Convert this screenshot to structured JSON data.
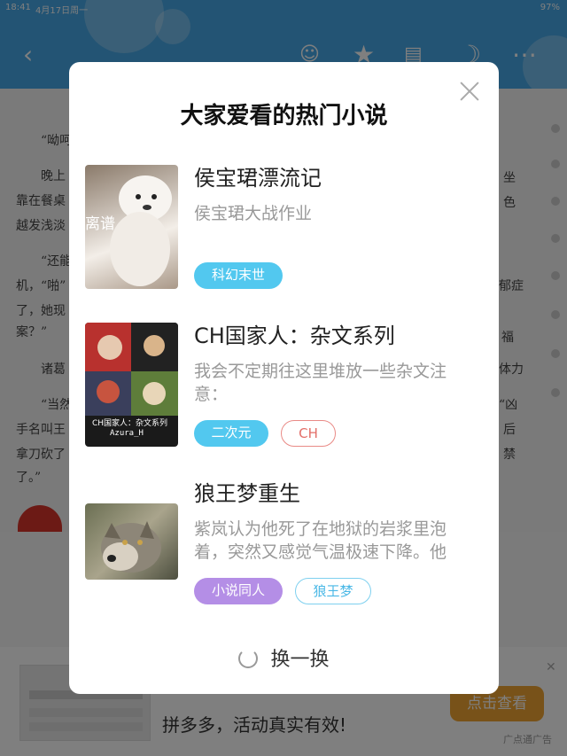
{
  "status_bar": {
    "time": "18:41",
    "date": "4月17日周一",
    "battery": "97%"
  },
  "reader": {
    "lines": [
      "“呦呵",
      "晚上",
      "靠在餐桌",
      "越发浅淡",
      "“还能",
      "机，“啪”",
      "了，她现",
      "案？”",
      "诸葛",
      "“当然",
      "手名叫王",
      "拿刀砍了",
      "了。”"
    ],
    "right_fragments": [
      "坐",
      "色",
      "郁症",
      "体力",
      "“凶",
      "后",
      "禁",
      "福"
    ]
  },
  "modal": {
    "title": "大家爱看的热门小说",
    "books": [
      {
        "title": "侯宝珺漂流记",
        "desc": "侯宝珺大战作业",
        "cover_text": "离谱",
        "tags": [
          {
            "label": "科幻末世",
            "style": "filled-blue"
          }
        ]
      },
      {
        "title": "CH国家人：杂文系列",
        "desc": "我会不定期往这里堆放一些杂文注意：",
        "cover_text": "CH国家人：杂文系列",
        "cover_author": "Azura_H",
        "tags": [
          {
            "label": "二次元",
            "style": "filled-blue"
          },
          {
            "label": "CH",
            "style": "outline-red"
          }
        ]
      },
      {
        "title": "狼王梦重生",
        "desc": "紫岚认为他死了在地狱的岩浆里泡着，突然又感觉气温极速下降。他",
        "tags": [
          {
            "label": "小说同人",
            "style": "filled-purple"
          },
          {
            "label": "狼王梦",
            "style": "outline-blue"
          }
        ]
      }
    ],
    "refresh_label": "换一换"
  },
  "ad": {
    "text": "拼多多，活动真实有效!",
    "button": "点击查看",
    "tag": "广点通广告"
  },
  "colors": {
    "header": "#47a9e8",
    "tag_blue": "#52c8ef",
    "tag_purple": "#b48ee6",
    "ad_button": "#f0a532"
  }
}
